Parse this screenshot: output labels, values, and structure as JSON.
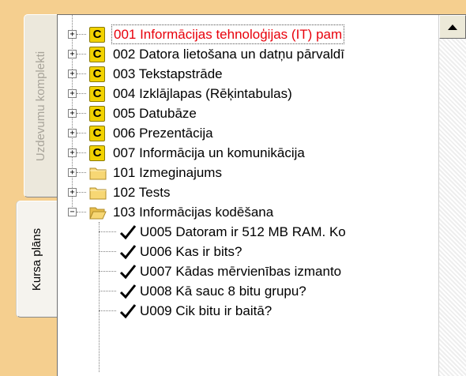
{
  "tabs": [
    {
      "label": "Uzdevumu komplekti",
      "active": false
    },
    {
      "label": "Kursa plāns",
      "active": true
    }
  ],
  "tree": {
    "items": [
      {
        "icon": "course-icon",
        "badge": "C",
        "label": "001 Informācijas tehnoloģijas (IT) pam",
        "expander": "+",
        "selected": true
      },
      {
        "icon": "course-icon",
        "badge": "C",
        "label": "002 Datora lietošana un datņu pārvaldī",
        "expander": "+"
      },
      {
        "icon": "course-icon",
        "badge": "C",
        "label": "003 Tekstapstrāde",
        "expander": "+"
      },
      {
        "icon": "course-icon",
        "badge": "C",
        "label": "004 Izklājlapas (Rēķintabulas)",
        "expander": "+"
      },
      {
        "icon": "course-icon",
        "badge": "C",
        "label": "005 Datubāze",
        "expander": "+"
      },
      {
        "icon": "course-icon",
        "badge": "C",
        "label": "006 Prezentācija",
        "expander": "+"
      },
      {
        "icon": "course-icon",
        "badge": "C",
        "label": "007 Informācija un komunikācija",
        "expander": "+"
      },
      {
        "icon": "folder-icon",
        "label": "101 Izmeginajums",
        "expander": "+"
      },
      {
        "icon": "folder-icon",
        "label": "102 Tests",
        "expander": "+"
      },
      {
        "icon": "folder-open-icon",
        "label": "103 Informācijas kodēšana",
        "expander": "−"
      }
    ],
    "children": [
      {
        "icon": "checkmark-icon",
        "label": "U005 Datoram ir 512 MB RAM. Ko"
      },
      {
        "icon": "checkmark-icon",
        "label": "U006 Kas ir bits?"
      },
      {
        "icon": "checkmark-icon",
        "label": "U007 Kādas mērvienības izmanto"
      },
      {
        "icon": "checkmark-icon",
        "label": "U008 Kā sauc 8 bitu grupu?"
      },
      {
        "icon": "checkmark-icon",
        "label": "U009 Cik bitu ir baitā?"
      }
    ]
  },
  "colors": {
    "background": "#f5cf8f",
    "selected_text": "#e8000b",
    "badge": "#f2d200"
  }
}
